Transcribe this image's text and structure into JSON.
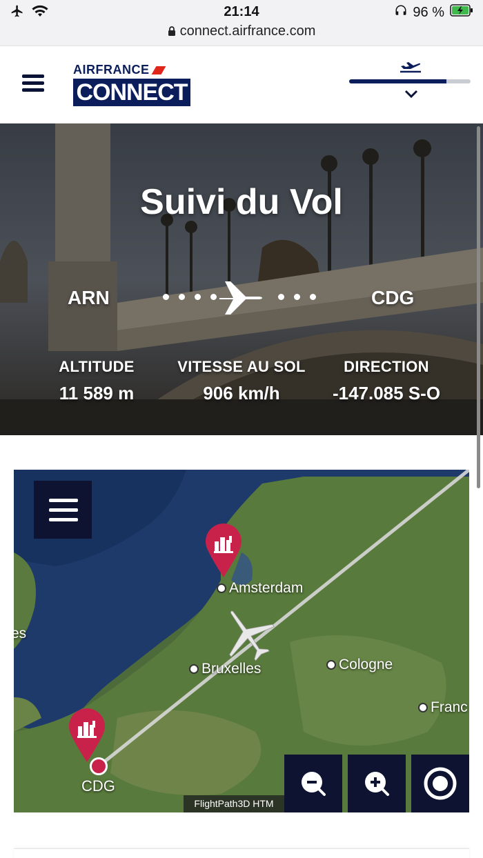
{
  "status_bar": {
    "time": "21:14",
    "battery": "96 %",
    "url": "connect.airfrance.com"
  },
  "header": {
    "logo_brand": "AIRFRANCE",
    "logo_product": "CONNECT",
    "flight_progress": 0.8
  },
  "hero": {
    "title": "Suivi du Vol",
    "origin": "ARN",
    "destination": "CDG",
    "stats": [
      {
        "label": "ALTITUDE",
        "value": "11 589 m"
      },
      {
        "label": "VITESSE AU SOL",
        "value": "906 km/h"
      },
      {
        "label": "DIRECTION",
        "value": "-147.085 S-O"
      }
    ]
  },
  "map": {
    "cities": {
      "amsterdam": "Amsterdam",
      "bruxelles": "Bruxelles",
      "cologne": "Cologne",
      "francfort": "Franc",
      "left_edge": "es"
    },
    "airport": "CDG",
    "attribution": "FlightPath3D HTM"
  }
}
